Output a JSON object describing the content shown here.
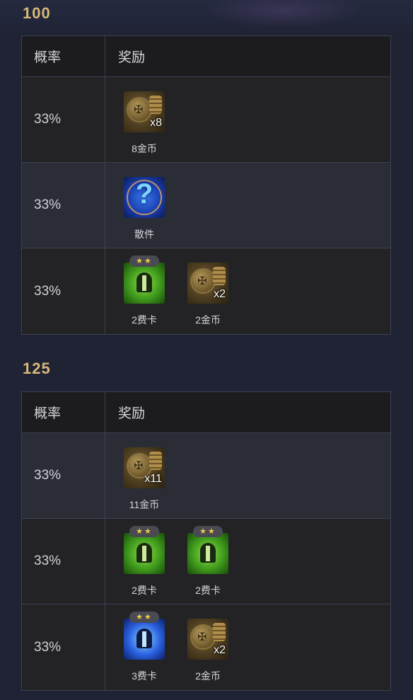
{
  "sections": [
    {
      "title": "100",
      "header": {
        "col1": "概率",
        "col2": "奖励"
      },
      "rows": [
        {
          "prob": "33%",
          "rewards": [
            {
              "type": "coin",
              "qty": "x8",
              "label": "8金币"
            }
          ]
        },
        {
          "prob": "33%",
          "rewards": [
            {
              "type": "mystery",
              "label": "散件"
            }
          ]
        },
        {
          "prob": "33%",
          "rewards": [
            {
              "type": "champ-green",
              "stars": "★★",
              "label": "2费卡"
            },
            {
              "type": "coin",
              "qty": "x2",
              "label": "2金币"
            }
          ]
        }
      ]
    },
    {
      "title": "125",
      "header": {
        "col1": "概率",
        "col2": "奖励"
      },
      "rows": [
        {
          "prob": "33%",
          "rewards": [
            {
              "type": "coin",
              "qty": "x11",
              "label": "11金币"
            }
          ]
        },
        {
          "prob": "33%",
          "rewards": [
            {
              "type": "champ-green",
              "stars": "★★",
              "label": "2费卡"
            },
            {
              "type": "champ-green",
              "stars": "★★",
              "label": "2费卡"
            }
          ]
        },
        {
          "prob": "33%",
          "rewards": [
            {
              "type": "champ-blue",
              "stars": "★★",
              "label": "3费卡"
            },
            {
              "type": "coin",
              "qty": "x2",
              "label": "2金币"
            }
          ]
        }
      ]
    }
  ],
  "icons": {
    "coin": "gold-coin-stack-icon",
    "mystery": "mystery-item-icon",
    "champ-green": "two-cost-champion-icon",
    "champ-blue": "three-cost-champion-icon"
  },
  "colors": {
    "background": "#1f2333",
    "section_title": "#d9b979",
    "table_border": "#3c4052",
    "row_alt": "#2b2d36"
  }
}
